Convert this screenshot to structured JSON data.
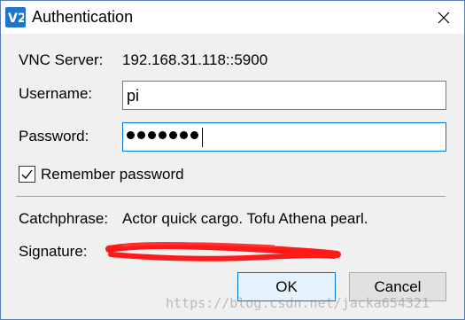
{
  "window": {
    "title": "Authentication",
    "app_icon_text": "V2",
    "accent_color": "#1f76c7"
  },
  "server": {
    "label": "VNC Server:",
    "value": "192.168.31.118::5900"
  },
  "username": {
    "label": "Username:",
    "value": "pi"
  },
  "password": {
    "label": "Password:",
    "masked_length": 7
  },
  "remember": {
    "label": "Remember password",
    "checked": true
  },
  "catchphrase": {
    "label": "Catchphrase:",
    "value": "Actor quick cargo. Tofu Athena pearl."
  },
  "signature": {
    "label": "Signature:",
    "redaction_color": "#ff0000"
  },
  "buttons": {
    "ok_label": "OK",
    "cancel_label": "Cancel"
  },
  "watermark": {
    "text": "https://blog.csdn.net/jacka654321"
  }
}
